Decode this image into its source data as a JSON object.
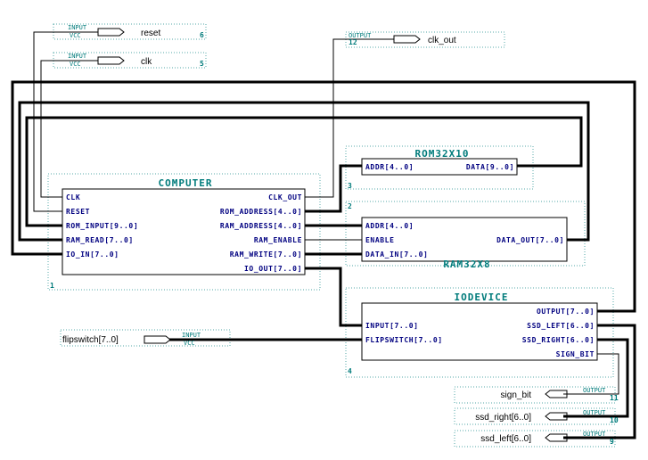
{
  "inputs": {
    "reset": {
      "kind1": "INPUT",
      "kind2": "VCC",
      "name": "reset",
      "num": "6"
    },
    "clk": {
      "kind1": "INPUT",
      "kind2": "VCC",
      "name": "clk",
      "num": "5"
    },
    "flipswitch": {
      "kind1": "INPUT",
      "kind2": "VCC",
      "name": "flipswitch[7..0]"
    }
  },
  "outputs": {
    "clk_out": {
      "kind": "OUTPUT",
      "name": "clk_out",
      "num": "12"
    },
    "sign_bit": {
      "kind": "OUTPUT",
      "name": "sign_bit",
      "num": "11"
    },
    "ssd_right": {
      "kind": "OUTPUT",
      "name": "ssd_right[6..0]",
      "num": "10"
    },
    "ssd_left": {
      "kind": "OUTPUT",
      "name": "ssd_left[6..0]",
      "num": "9"
    }
  },
  "computer": {
    "title": "COMPUTER",
    "num": "1",
    "left_pins": [
      "CLK",
      "RESET",
      "ROM_INPUT[9..0]",
      "RAM_READ[7..0]",
      "IO_IN[7..0]"
    ],
    "right_pins": [
      "CLK_OUT",
      "ROM_ADDRESS[4..0]",
      "RAM_ADDRESS[4..0]",
      "RAM_ENABLE",
      "RAM_WRITE[7..0]",
      "IO_OUT[7..0]"
    ]
  },
  "rom": {
    "title": "ROM32X10",
    "num": "3",
    "left_pin": "ADDR[4..0]",
    "right_pin": "DATA[9..0]"
  },
  "ram": {
    "title": "RAM32X8",
    "num": "2",
    "left_pins": [
      "ADDR[4..0]",
      "ENABLE",
      "DATA_IN[7..0]"
    ],
    "right_pin": "DATA_OUT[7..0]"
  },
  "iodevice": {
    "title": "IODEVICE",
    "num": "4",
    "left_pins": [
      "INPUT[7..0]",
      "FLIPSWITCH[7..0]"
    ],
    "right_pins": [
      "OUTPUT[7..0]",
      "SSD_LEFT[6..0]",
      "SSD_RIGHT[6..0]",
      "SIGN_BIT"
    ]
  }
}
